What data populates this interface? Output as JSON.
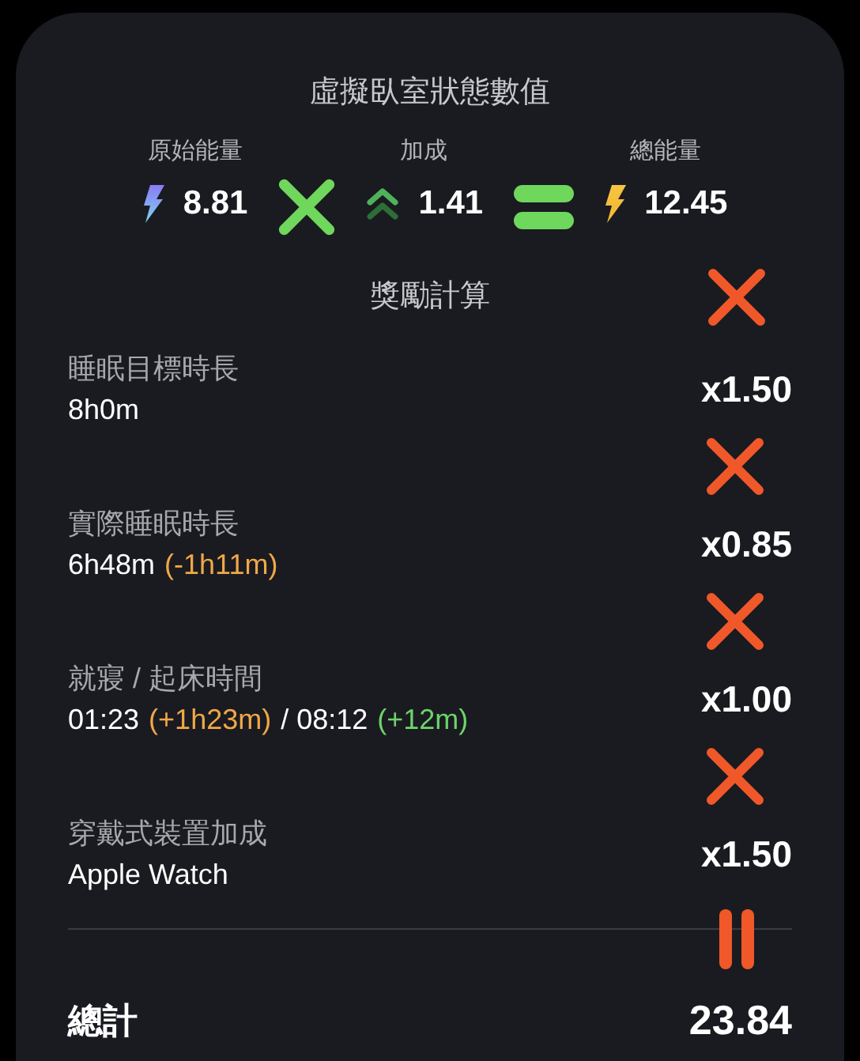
{
  "title": "虛擬臥室狀態數值",
  "stats": [
    {
      "kind": "raw",
      "label": "原始能量",
      "value": "8.81"
    },
    {
      "kind": "multiply"
    },
    {
      "kind": "bonus",
      "label": "加成",
      "value": "1.41"
    },
    {
      "kind": "equals"
    },
    {
      "kind": "total",
      "label": "總能量",
      "value": "12.45"
    }
  ],
  "bonus_section": {
    "title": "獎勵計算",
    "rows": [
      {
        "label": "睡眠目標時長",
        "value": [
          {
            "text": "8h0m",
            "color": "#ffffff"
          }
        ],
        "multiplier": "x1.50"
      },
      {
        "label": "實際睡眠時長",
        "value": [
          {
            "text": "6h48m",
            "color": "#ffffff"
          },
          {
            "text": "(-1h11m)",
            "color": "#f0a848"
          }
        ],
        "multiplier": "x0.85"
      },
      {
        "label": "就寢 / 起床時間",
        "value": [
          {
            "text": "01:23",
            "color": "#ffffff"
          },
          {
            "text": "(+1h23m)",
            "color": "#f0a848"
          },
          {
            "text": "/ 08:12",
            "color": "#ffffff"
          },
          {
            "text": "(+12m)",
            "color": "#6cd46a"
          }
        ],
        "multiplier": "x1.00"
      },
      {
        "label": "穿戴式裝置加成",
        "value": [
          {
            "text": "Apple Watch",
            "color": "#ffffff"
          }
        ],
        "multiplier": "x1.50"
      }
    ]
  },
  "total": {
    "label": "總計",
    "value": "23.84"
  }
}
